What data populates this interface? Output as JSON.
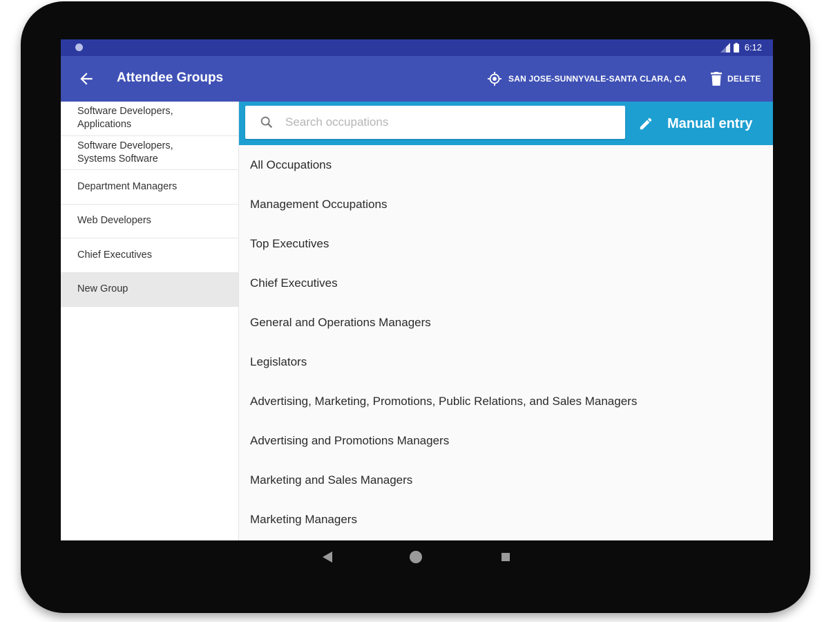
{
  "status_bar": {
    "time": "6:12"
  },
  "app_bar": {
    "title": "Attendee Groups",
    "location": "SAN JOSE-SUNNYVALE-SANTA CLARA, CA",
    "delete_label": "DELETE"
  },
  "groups": [
    {
      "line1": "Software Developers,",
      "line2": "Applications"
    },
    {
      "line1": "Software Developers,",
      "line2": "Systems Software"
    },
    {
      "line1": "Department Managers",
      "line2": ""
    },
    {
      "line1": "Web Developers",
      "line2": ""
    },
    {
      "line1": "Chief Executives",
      "line2": ""
    },
    {
      "line1": "New Group",
      "line2": ""
    }
  ],
  "selected_group": "New Group",
  "search": {
    "placeholder": "Search occupations",
    "value": ""
  },
  "manual_entry_label": "Manual entry",
  "occupations": [
    "All Occupations",
    "Management Occupations",
    "Top Executives",
    "Chief Executives",
    "General and Operations Managers",
    "Legislators",
    "Advertising, Marketing, Promotions, Public Relations, and Sales Managers",
    "Advertising and Promotions Managers",
    "Marketing and Sales Managers",
    "Marketing Managers"
  ],
  "colors": {
    "app_bar": "#3f51b5",
    "status_bar": "#2c3aa0",
    "search_bar": "#1e9fd2"
  },
  "icons": [
    "back-arrow-icon",
    "location-target-icon",
    "trash-icon",
    "search-icon",
    "pencil-icon",
    "signal-icon",
    "battery-icon",
    "nav-back-icon",
    "nav-home-icon",
    "nav-recent-icon"
  ]
}
